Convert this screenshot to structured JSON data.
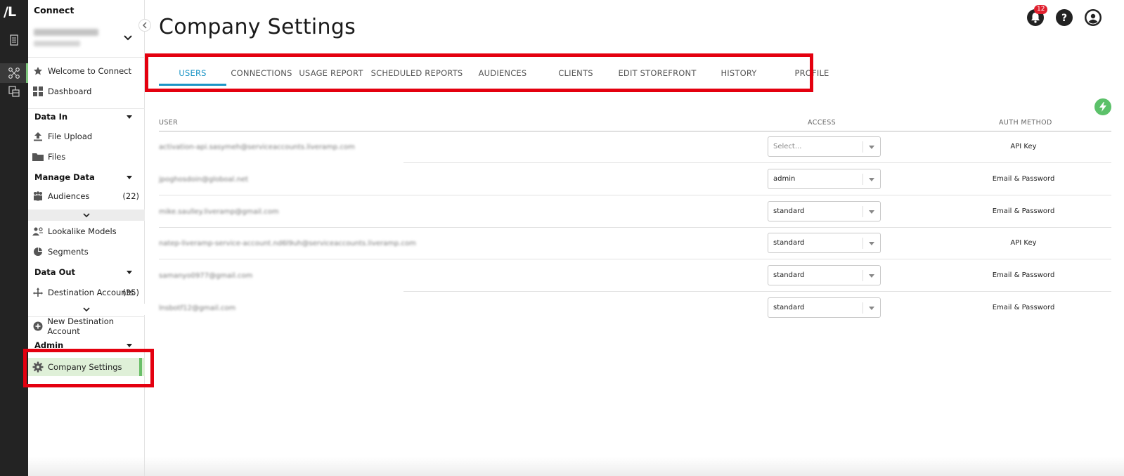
{
  "app": {
    "logo_text": "/L",
    "name": "Connect"
  },
  "sidebar": {
    "items": {
      "welcome": "Welcome to Connect",
      "dashboard": "Dashboard",
      "file_upload": "File Upload",
      "files": "Files",
      "audiences": "Audiences",
      "audiences_count": "(22)",
      "lookalike": "Lookalike Models",
      "segments": "Segments",
      "destination_accounts": "Destination Accounts",
      "destination_accounts_count": "(35)",
      "new_destination": "New Destination Account",
      "company_settings": "Company Settings"
    },
    "sections": {
      "data_in": "Data In",
      "manage_data": "Manage Data",
      "data_out": "Data Out",
      "admin": "Admin"
    }
  },
  "header": {
    "title": "Company Settings",
    "notification_count": "12"
  },
  "tabs": [
    "USERS",
    "CONNECTIONS",
    "USAGE REPORT",
    "SCHEDULED REPORTS",
    "AUDIENCES",
    "CLIENTS",
    "EDIT STOREFRONT",
    "HISTORY",
    "PROFILE"
  ],
  "active_tab": "USERS",
  "table": {
    "columns": {
      "user": "USER",
      "access": "ACCESS",
      "auth": "AUTH METHOD"
    },
    "rows": [
      {
        "user": "activation-api.sasymeh@serviceaccounts.liveramp.com",
        "access": "Select...",
        "auth": "API Key"
      },
      {
        "user": "jpoghosdoin@globoal.net",
        "access": "admin",
        "auth": "Email & Password"
      },
      {
        "user": "mike.saulley.liveramp@gmail.com",
        "access": "standard",
        "auth": "Email & Password"
      },
      {
        "user": "natep-liveramp-service-account.nd6l9uh@serviceaccounts.liveramp.com",
        "access": "standard",
        "auth": "API Key"
      },
      {
        "user": "samanyo0977@gmail.com",
        "access": "standard",
        "auth": "Email & Password"
      },
      {
        "user": "lnsbotf12@gmail.com",
        "access": "standard",
        "auth": "Email & Password"
      }
    ]
  },
  "colors": {
    "accent": "#1c95c6",
    "highlight": "#e4000f",
    "selected_bg": "#dff0d8",
    "rail": "#232323"
  }
}
